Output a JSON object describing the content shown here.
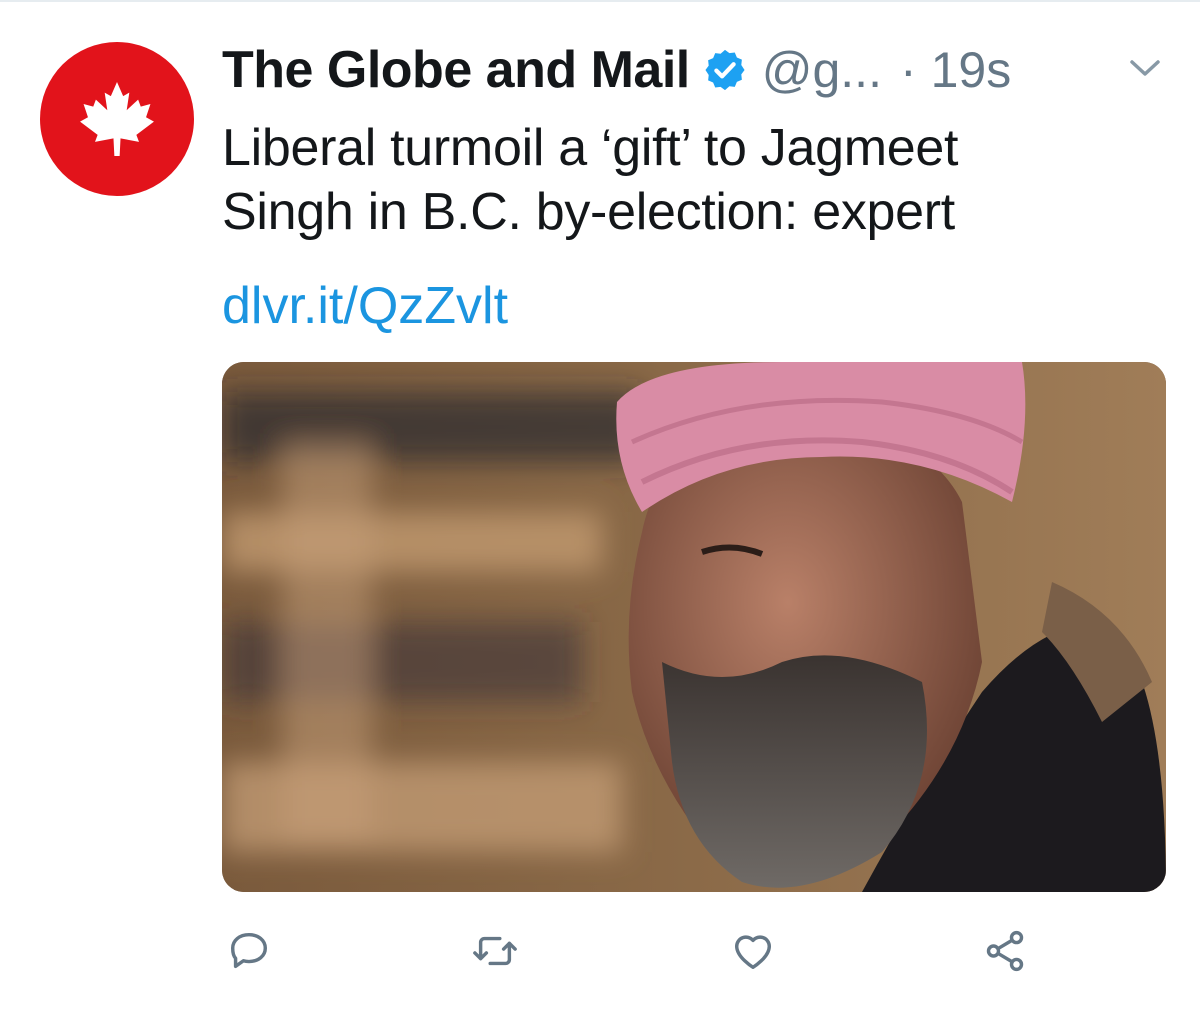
{
  "tweet": {
    "author": {
      "display_name": "The Globe and Mail",
      "handle": "@g...",
      "verified": true,
      "avatar_icon": "maple-leaf-icon",
      "avatar_color": "#e2131b"
    },
    "separator": "·",
    "timestamp": "19s",
    "text_line_1": "Liberal turmoil a ‘gift’ to Jagmeet",
    "text_line_2": "Singh in B.C. by-election: expert",
    "link": "dlvr.it/QzZvlt",
    "media": {
      "kind": "photo"
    },
    "actions": {
      "reply_icon": "reply-icon",
      "retweet_icon": "retweet-icon",
      "like_icon": "heart-icon",
      "share_icon": "share-icon"
    },
    "menu_icon": "chevron-down-icon"
  },
  "colors": {
    "name": "#14171a",
    "secondary": "#657786",
    "link": "#1b95e0",
    "verified": "#1da1f2",
    "icon": "#657786"
  }
}
